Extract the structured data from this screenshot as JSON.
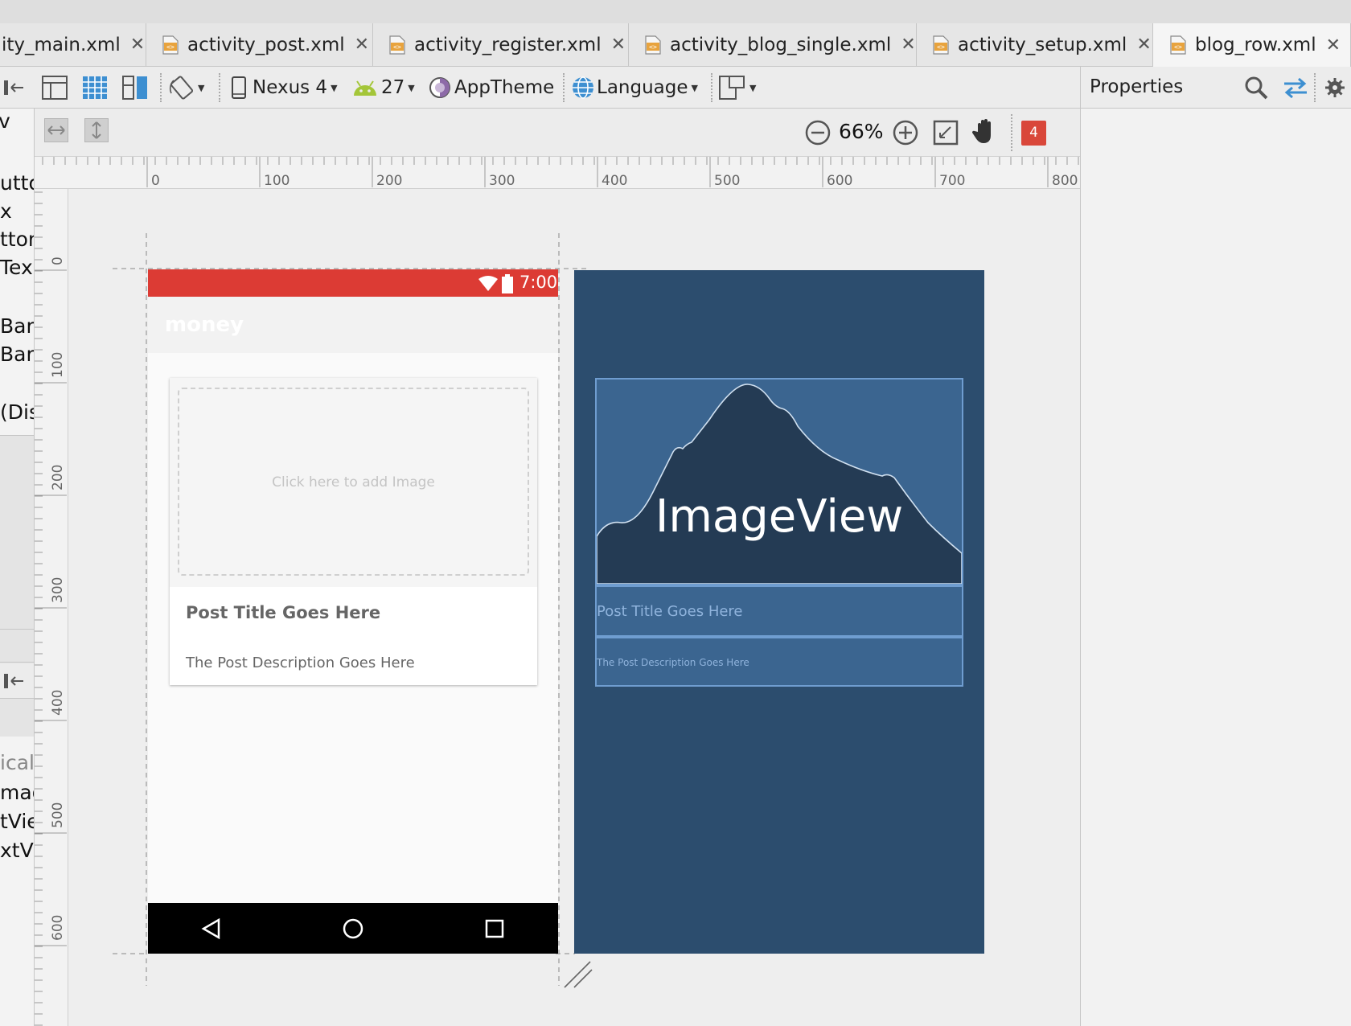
{
  "tabs": [
    {
      "label": "ity_main.xml",
      "active": false
    },
    {
      "label": "activity_post.xml",
      "active": false
    },
    {
      "label": "activity_register.xml",
      "active": false
    },
    {
      "label": "activity_blog_single.xml",
      "active": false
    },
    {
      "label": "activity_setup.xml",
      "active": false
    },
    {
      "label": "blog_row.xml",
      "active": true
    }
  ],
  "tab_close": "✕",
  "toolbar": {
    "device": "Nexus 4",
    "api": "27",
    "theme": "AppTheme",
    "language": "Language"
  },
  "zoom": {
    "level": "66%"
  },
  "warnings": {
    "count": "4"
  },
  "properties": {
    "title": "Properties"
  },
  "palette_fragments": [
    "v",
    "utto",
    "x",
    "tton",
    "Tex",
    "Bar",
    "Bar",
    "(Dis"
  ],
  "tree_fragments": [
    "ical",
    "mag",
    "tVie",
    "xtVi"
  ],
  "ruler": {
    "h_labels": [
      "0",
      "100",
      "200",
      "300",
      "400",
      "500",
      "600",
      "700",
      "800"
    ],
    "v_labels": [
      "0",
      "100",
      "200",
      "300",
      "400",
      "500",
      "600"
    ]
  },
  "phone": {
    "status_time": "7:00",
    "app_title": "money",
    "image_placeholder": "Click here to add Image",
    "post_title": "Post Title Goes Here",
    "post_description": "The Post Description Goes Here"
  },
  "blueprint": {
    "image_label": "ImageView",
    "post_title": "Post Title Goes Here",
    "post_description": "The Post Description Goes Here"
  },
  "colors": {
    "status_bar": "#dc3b34",
    "blueprint_bg": "#2c4d6e",
    "blueprint_box": "#3b6590",
    "blueprint_border": "#6f9dd0",
    "android_green": "#a4c639",
    "warning_red": "#d9473a"
  }
}
